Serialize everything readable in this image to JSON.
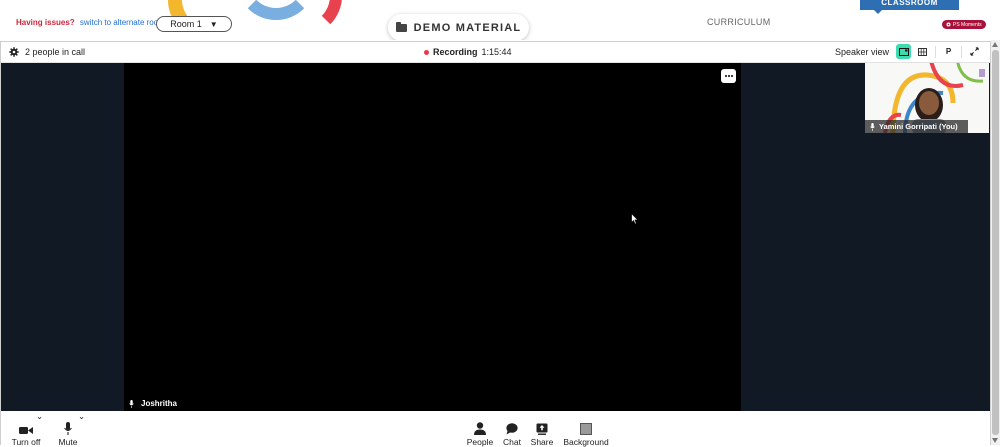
{
  "header": {
    "issues_label": "Having issues?",
    "switch_link": "switch to alternate room",
    "room_value": "Room 1",
    "demo_tab": "DEMO MATERIAL",
    "curriculum_tab": "CURRICULUM",
    "classroom_tab": "CLASSROOM",
    "moments_badge": "PS Moments"
  },
  "call": {
    "people_count": "2 people in call",
    "recording_label": "Recording",
    "recording_time": "1:15:44",
    "view_label": "Speaker view",
    "p_button": "P"
  },
  "main_tile": {
    "participant_name": "Joshritha"
  },
  "self_tile": {
    "participant_name": "Yamini Gorripati (You)"
  },
  "controls": {
    "camera": "Turn off",
    "mic": "Mute",
    "people": "People",
    "chat": "Chat",
    "share": "Share",
    "background": "Background"
  },
  "colors": {
    "accent_green": "#3ddcb0",
    "recording_red": "#e53950",
    "stage_bg": "#111a24",
    "link_blue": "#1f6fd1",
    "warn_red": "#d0263a"
  }
}
